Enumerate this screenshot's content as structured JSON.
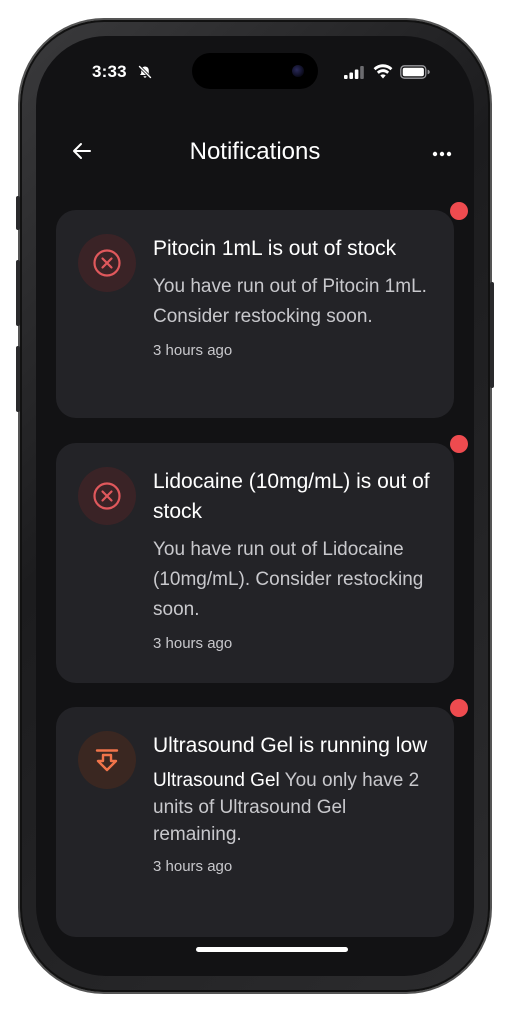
{
  "status_bar": {
    "time": "3:33"
  },
  "nav": {
    "title": "Notifications"
  },
  "notifications": [
    {
      "title": "Pitocin 1mL is out of stock",
      "message": "You have run out of Pitocin 1mL. Consider restocking soon.",
      "time": "3 hours ago",
      "icon": "x-circle-icon",
      "status": "danger",
      "unread": true
    },
    {
      "title": "Lidocaine (10mg/mL) is out of stock",
      "message": "You have run out of Lidocaine (10mg/mL). Consider restocking soon.",
      "time": "3 hours ago",
      "icon": "x-circle-icon",
      "status": "danger",
      "unread": true
    },
    {
      "title": "Ultrasound Gel is running low",
      "message_strong": "Ultrasound Gel",
      "message": " You only have 2 units of Ultrasound Gel remaining.",
      "time": "3 hours ago",
      "icon": "arrow-down-icon",
      "status": "warning",
      "unread": true
    }
  ],
  "colors": {
    "background": "#121214",
    "card": "#232327",
    "danger": "#e0585c",
    "warning": "#f0744a",
    "unread_dot": "#ee4b4f",
    "text_primary": "#ffffff",
    "text_secondary": "#c8c8cc"
  }
}
